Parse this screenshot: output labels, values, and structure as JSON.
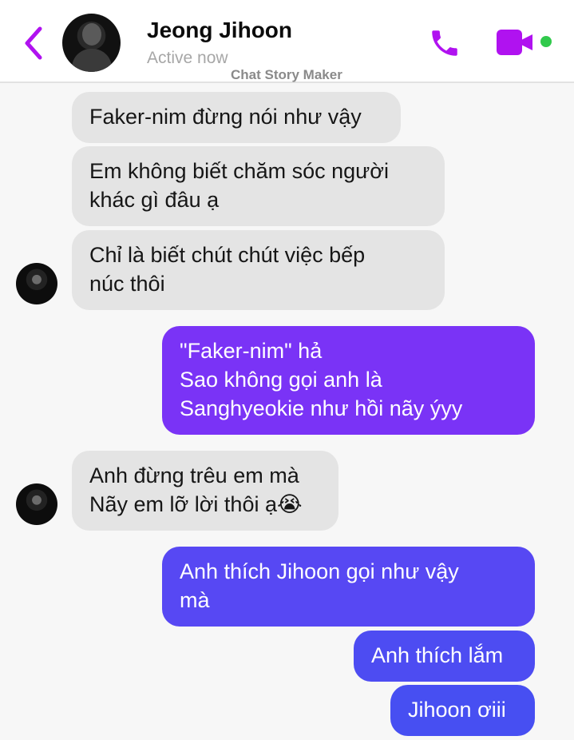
{
  "header": {
    "contact_name": "Jeong Jihoon",
    "status": "Active now",
    "watermark": "Chat Story Maker",
    "icons": {
      "back": "chevron-left-icon",
      "call": "phone-icon",
      "video": "video-camera-icon"
    },
    "colors": {
      "accent": "#b012f0",
      "online": "#31c94c"
    }
  },
  "messages": [
    {
      "from": "them",
      "text": "Faker-nim đừng nói như vậy"
    },
    {
      "from": "them",
      "text": "Em không biết chăm sóc người\nkhác gì đâu ạ"
    },
    {
      "from": "them",
      "text": "Chỉ là biết chút chút việc bếp\nnúc thôi"
    },
    {
      "from": "me",
      "text": "\"Faker-nim\" hả\nSao không gọi anh là\nSanghyeokie như hồi nãy ýyy"
    },
    {
      "from": "them",
      "text": "Anh đừng trêu em mà\nNãy em lỡ lời thôi ạ😭"
    },
    {
      "from": "me",
      "text": "Anh thích Jihoon gọi như vậy\nmà"
    },
    {
      "from": "me",
      "text": "Anh thích lắm"
    },
    {
      "from": "me",
      "text": "Jihoon ơiii"
    }
  ],
  "bubble_colors": {
    "incoming": "#e4e4e4",
    "outgoing": [
      "#7a33f6",
      "#6b3ef5",
      "#5748f3",
      "#4d4cf2",
      "#474ff2"
    ]
  }
}
